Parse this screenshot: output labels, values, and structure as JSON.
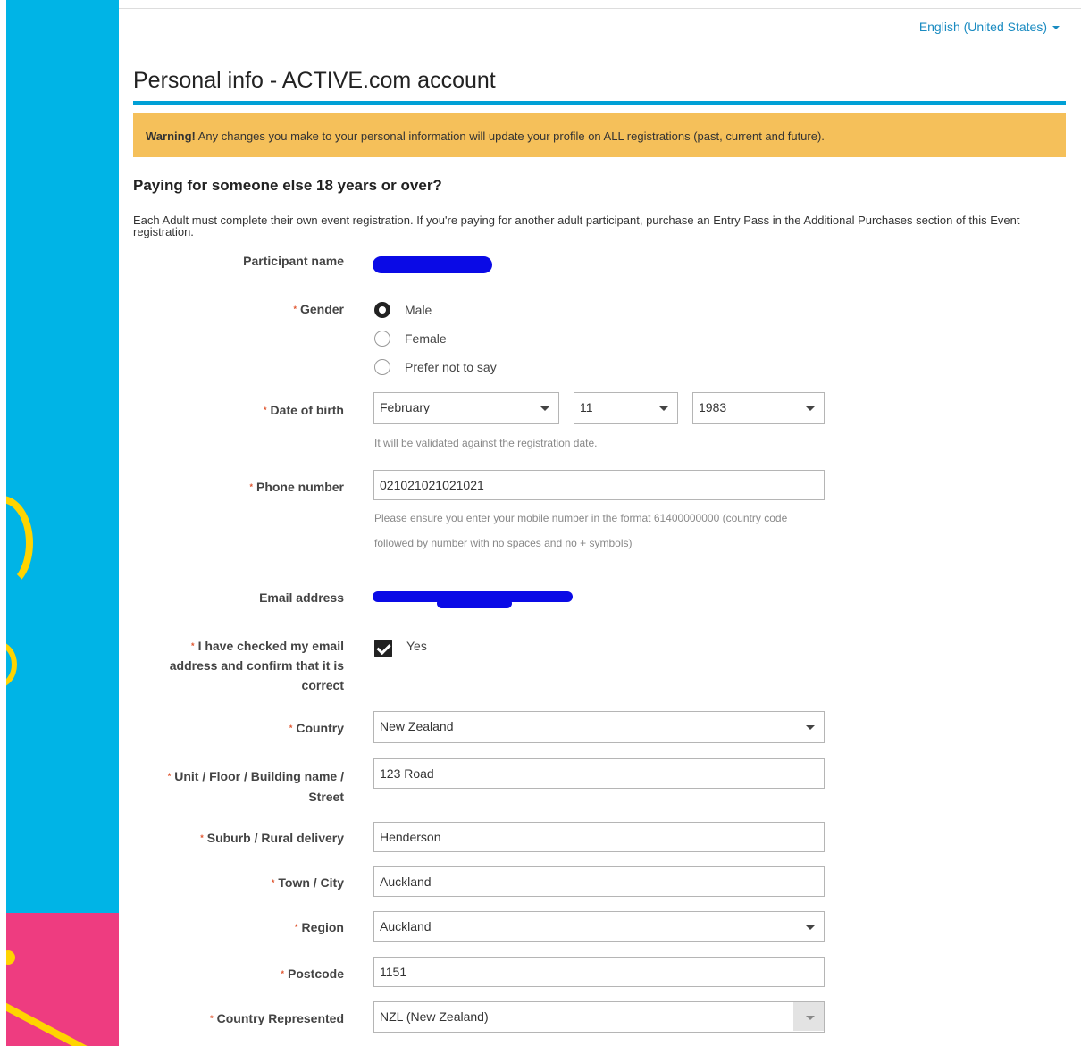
{
  "header": {
    "language": "English (United States)"
  },
  "page": {
    "title": "Personal info - ACTIVE.com account",
    "warning_strong": "Warning!",
    "warning_text": " Any changes you make to your personal information will update your profile on ALL registrations (past, current and future).",
    "subhead": "Paying for someone else 18 years or over?",
    "info": "Each Adult must complete their own event registration. If you're paying for another adult participant, purchase an Entry Pass in the Additional Purchases section of this Event registration."
  },
  "form": {
    "participant_name_label": "Participant name",
    "gender": {
      "label": "Gender",
      "options": [
        "Male",
        "Female",
        "Prefer not to say"
      ],
      "selected": "Male"
    },
    "dob": {
      "label": "Date of birth",
      "month": "February",
      "day": "11",
      "year": "1983",
      "help": "It will be validated against the registration date."
    },
    "phone": {
      "label": "Phone number",
      "value": "021021021021021",
      "help": "Please ensure you enter your mobile number in the format 61400000000 (country code followed by number with no spaces and no + symbols)"
    },
    "email_label": "Email address",
    "confirm_email": {
      "label": "I have checked my email address and confirm that it is correct",
      "option": "Yes",
      "checked": true
    },
    "country": {
      "label": "Country",
      "value": "New Zealand"
    },
    "street": {
      "label": "Unit / Floor / Building name / Street",
      "value": "123 Road"
    },
    "suburb": {
      "label": "Suburb / Rural delivery",
      "value": "Henderson"
    },
    "town": {
      "label": "Town / City",
      "value": "Auckland"
    },
    "region": {
      "label": "Region",
      "value": "Auckland"
    },
    "postcode": {
      "label": "Postcode",
      "value": "1151"
    },
    "country_represented": {
      "label": "Country Represented",
      "value": "NZL (New Zealand)"
    }
  },
  "colors": {
    "accent": "#00a0d6",
    "warning_bg": "#f5c05a",
    "sidebar_blue": "#00b4e6",
    "sidebar_pink": "#ee3c80",
    "sidebar_yellow": "#ffd400",
    "redaction": "#0a0ae6",
    "required_asterisk": "#e0552f"
  }
}
